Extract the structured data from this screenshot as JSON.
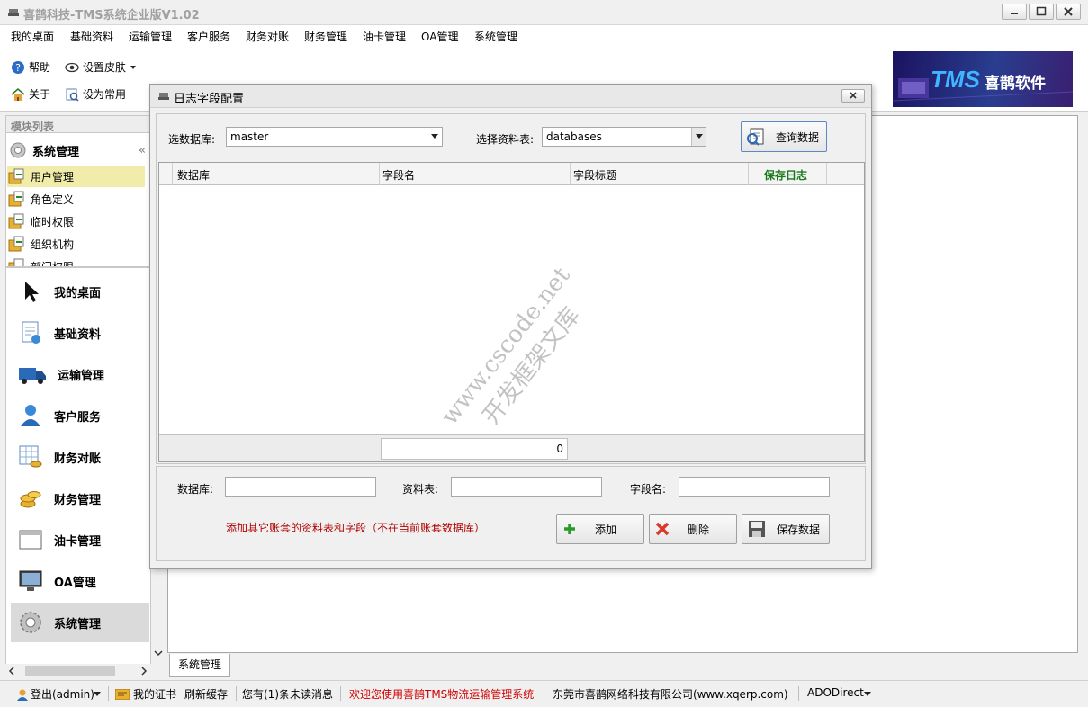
{
  "app": {
    "title": "喜鹊科技-TMS系统企业版V1.02"
  },
  "menu": [
    "我的桌面",
    "基础资料",
    "运输管理",
    "客户服务",
    "财务对账",
    "财务管理",
    "油卡管理",
    "OA管理",
    "系统管理"
  ],
  "toolbar": {
    "help": "帮助",
    "skin": "设置皮肤",
    "about": "关于",
    "favorite": "设为常用"
  },
  "banner": {
    "brand": "TMS",
    "company": "喜鹊软件"
  },
  "sidebar": {
    "header": "模块列表",
    "group": "系统管理",
    "subitems": [
      "用户管理",
      "角色定义",
      "临时权限",
      "组织机构",
      "部门权限"
    ],
    "nav": [
      "我的桌面",
      "基础资料",
      "运输管理",
      "客户服务",
      "财务对账",
      "财务管理",
      "油卡管理",
      "OA管理",
      "系统管理"
    ]
  },
  "tab": {
    "active": "系统管理"
  },
  "dialog": {
    "title": "日志字段配置",
    "db_label": "选数据库:",
    "db_value": "master",
    "table_label": "选择资料表:",
    "table_value": "databases",
    "query_button": "查询数据",
    "columns": [
      "数据库",
      "字段名",
      "字段标题",
      "保存日志"
    ],
    "count": "0",
    "f_db": "数据库:",
    "f_table": "资料表:",
    "f_field": "字段名:",
    "note": "添加其它账套的资料表和字段（不在当前账套数据库）",
    "add": "添加",
    "delete": "删除",
    "save": "保存数据",
    "colors": {
      "note": "#b00000",
      "save_log_header": "#1a7a1a"
    }
  },
  "watermark": {
    "line1": "www.cscode.net",
    "line2": "开发框架文库"
  },
  "status": {
    "logout": "登出(admin)",
    "cert": "我的证书",
    "refresh": "刷新缓存",
    "messages": "您有(1)条未读消息",
    "welcome": "欢迎您使用喜鹊TMS物流运输管理系统",
    "company": "东莞市喜鹊网络科技有限公司(www.xqerp.com)",
    "mode": "ADODirect"
  }
}
